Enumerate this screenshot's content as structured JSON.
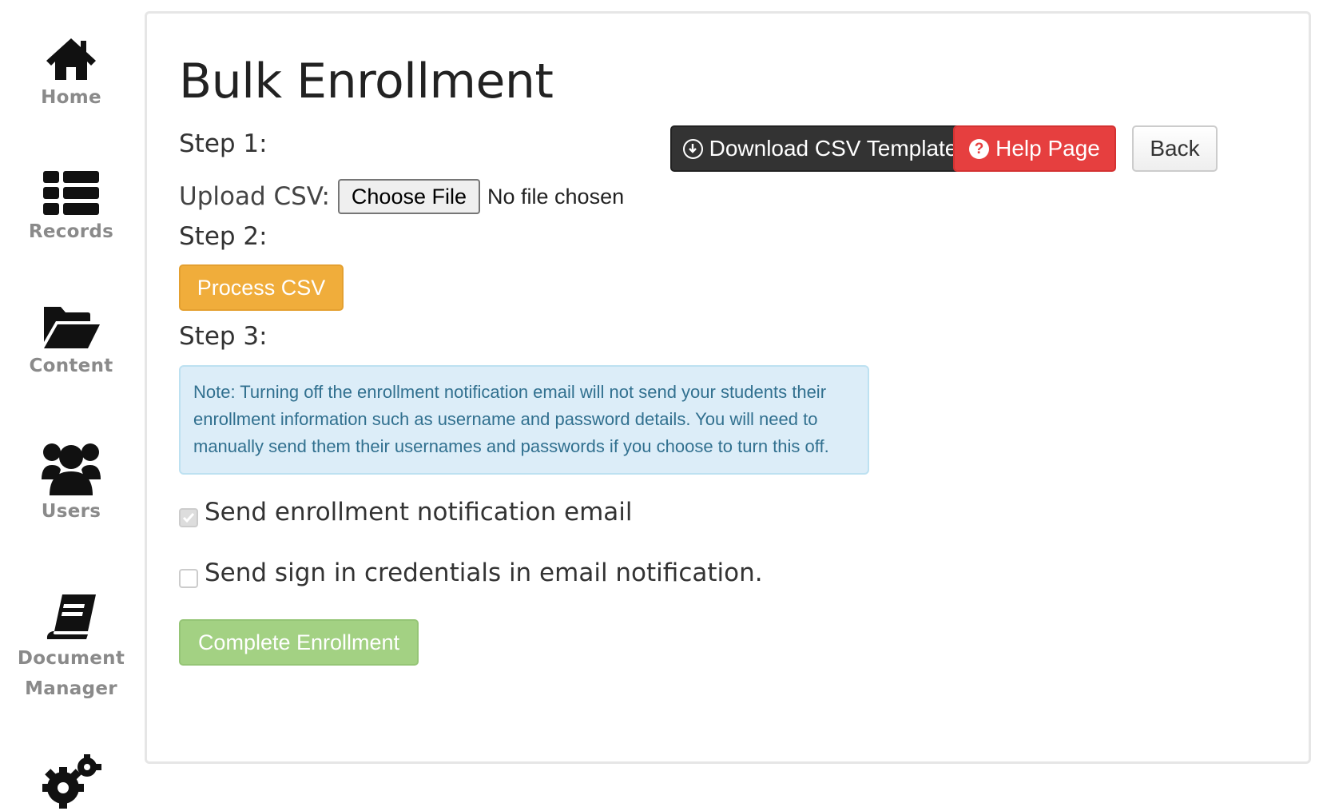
{
  "sidebar": {
    "items": [
      {
        "label": "Home",
        "icon": "home-icon"
      },
      {
        "label": "Records",
        "icon": "list-icon"
      },
      {
        "label": "Content",
        "icon": "folder-open-icon"
      },
      {
        "label": "Users",
        "icon": "users-icon"
      },
      {
        "label": "Document",
        "label2": "Manager",
        "icon": "book-icon"
      },
      {
        "label": "",
        "icon": "gears-icon"
      }
    ],
    "label_color": "#8a8a8a"
  },
  "page": {
    "title": "Bulk Enrollment"
  },
  "step1": {
    "label": "Step 1:",
    "upload_label": "Upload CSV:",
    "choose_file_label": "Choose File",
    "file_status": "No file chosen"
  },
  "toolbar": {
    "download_label": "Download CSV Template",
    "help_label": "Help Page",
    "back_label": "Back"
  },
  "step2": {
    "label": "Step 2:",
    "process_label": "Process CSV"
  },
  "step3": {
    "label": "Step 3:",
    "note": "Note: Turning off the enrollment notification email will not send your students their enrollment information such as username and password details. You will need to manually send them their usernames and passwords if you choose to turn this off."
  },
  "options": {
    "send_notification": {
      "label": "Send enrollment notification email",
      "checked": true,
      "disabled": true
    },
    "send_credentials": {
      "label": "Send sign in credentials in email notification.",
      "checked": false
    }
  },
  "complete": {
    "label": "Complete Enrollment"
  },
  "colors": {
    "dark_button": "#333333",
    "danger_button": "#e63f3f",
    "warning_button": "#f0ad3b",
    "success_button": "#a3d183",
    "alert_bg": "#dcedf8",
    "alert_text": "#31708f"
  }
}
